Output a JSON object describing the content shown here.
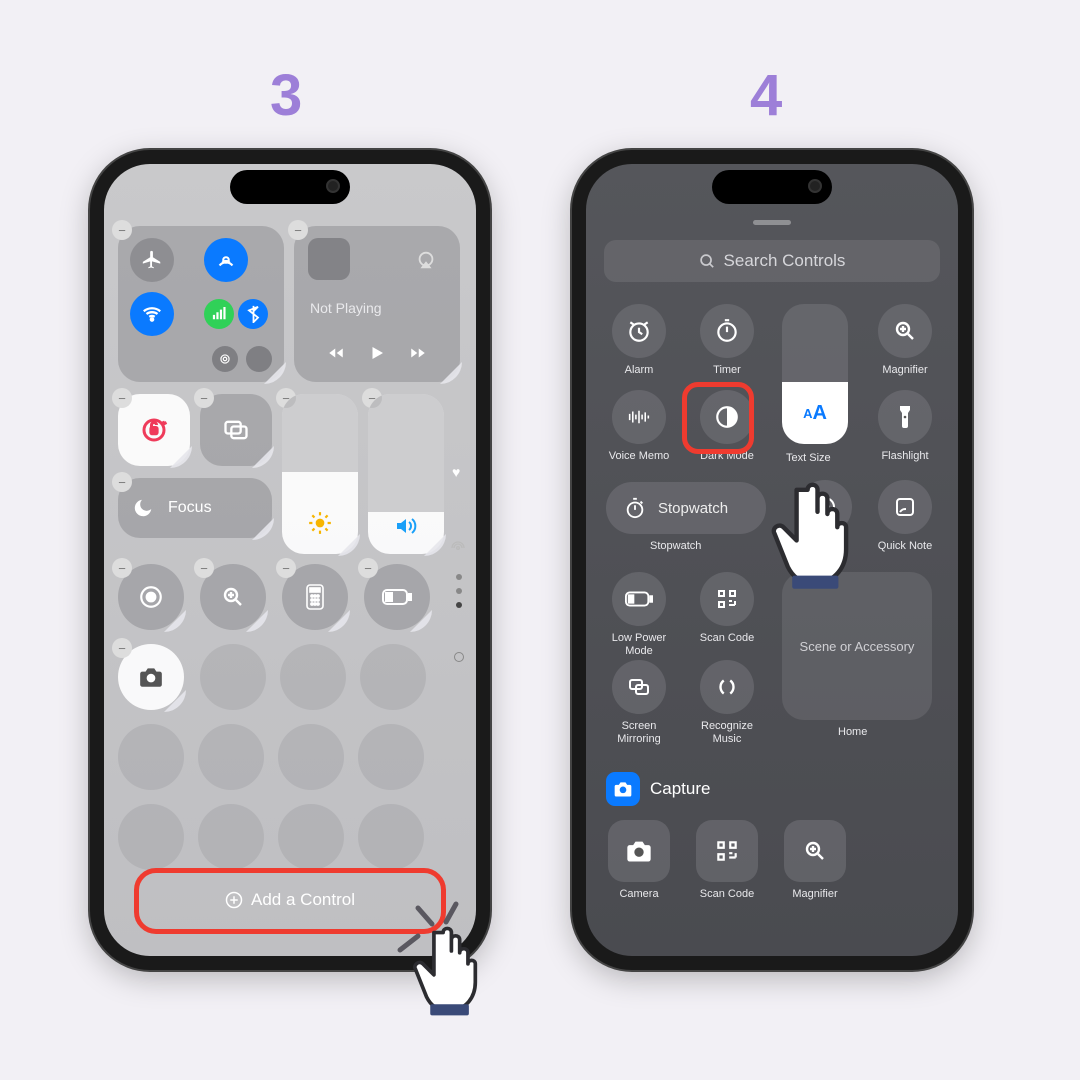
{
  "steps": {
    "left": "3",
    "right": "4"
  },
  "left": {
    "media_status": "Not Playing",
    "focus_label": "Focus",
    "add_control": "Add a Control"
  },
  "right": {
    "search_placeholder": "Search Controls",
    "items": {
      "alarm": "Alarm",
      "timer": "Timer",
      "magnifier": "Magnifier",
      "voice_memo": "Voice Memo",
      "dark_mode": "Dark Mode",
      "text_size": "Text Size",
      "flashlight": "Flashlight",
      "stopwatch_btn": "Stopwatch",
      "stopwatch_lbl": "Stopwatch",
      "quick_note": "Quick Note",
      "low_power": "Low Power\nMode",
      "scan_code": "Scan Code",
      "screen_mirroring": "Screen\nMirroring",
      "recognize_music": "Recognize\nMusic",
      "scene": "Scene or Accessory",
      "home": "Home",
      "capture": "Capture",
      "camera": "Camera",
      "scan_code2": "Scan Code",
      "magnifier2": "Magnifier"
    }
  }
}
